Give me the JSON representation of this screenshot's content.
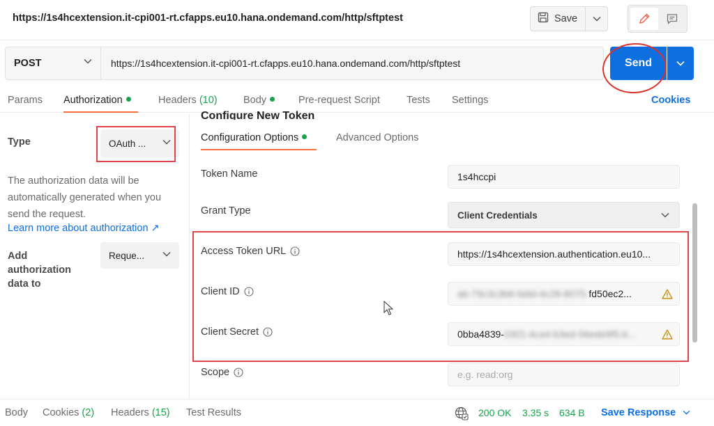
{
  "header": {
    "request_title": "https://1s4hcextension.it-cpi001-rt.cfapps.eu10.hana.ondemand.com/http/sftptest",
    "save_label": "Save"
  },
  "request": {
    "method": "POST",
    "url": "https://1s4hcextension.it-cpi001-rt.cfapps.eu10.hana.ondemand.com/http/sftptest",
    "send_label": "Send"
  },
  "tabs": {
    "params": "Params",
    "authorization": "Authorization",
    "headers": "Headers",
    "headers_count": "(10)",
    "body": "Body",
    "prerequest": "Pre-request Script",
    "tests": "Tests",
    "settings": "Settings",
    "cookies": "Cookies"
  },
  "auth": {
    "type_label": "Type",
    "type_value": "OAuth ...",
    "description": "The authorization data will be automatically generated when you send the request.",
    "learn_more": "Learn more about authorization ↗",
    "add_label": "Add authorization data to",
    "add_value": "Reque..."
  },
  "config": {
    "heading": "Configure New Token",
    "tab_options": "Configuration Options",
    "tab_advanced": "Advanced Options",
    "fields": {
      "token_name_label": "Token Name",
      "token_name_value": "1s4hccpi",
      "grant_type_label": "Grant Type",
      "grant_type_value": "Client Credentials",
      "access_token_url_label": "Access Token URL",
      "access_token_url_value": "https://1s4hcextension.authentication.eu10...",
      "client_id_label": "Client ID",
      "client_id_visible": "fd50ec2...",
      "client_secret_label": "Client Secret",
      "client_secret_visible": "0bba4839-",
      "scope_label": "Scope",
      "scope_placeholder": "e.g. read:org"
    }
  },
  "response": {
    "body": "Body",
    "cookies": "Cookies",
    "cookies_count": "(2)",
    "headers": "Headers",
    "headers_count": "(15)",
    "test_results": "Test Results",
    "status": "200 OK",
    "time": "3.35 s",
    "size": "634 B",
    "save_response": "Save Response"
  },
  "colors": {
    "accent_blue": "#0d6fe0",
    "tab_underline": "#ff6c37",
    "status_green": "#16a34a",
    "annotation_red": "#e0444a"
  }
}
